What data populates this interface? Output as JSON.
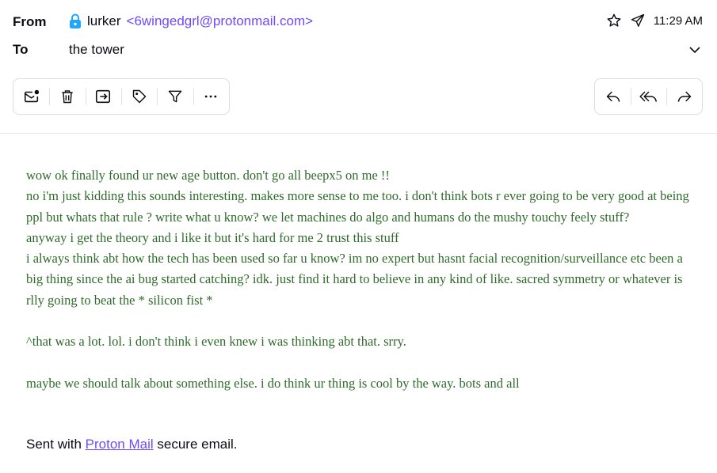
{
  "header": {
    "from_label": "From",
    "to_label": "To",
    "sender_name": "lurker",
    "sender_email": "<6wingedgrl@protonmail.com>",
    "recipient": "the tower",
    "time": "11:29 AM"
  },
  "toolbar": {
    "left": [
      {
        "icon": "mark-unread-icon"
      },
      {
        "icon": "trash-icon"
      },
      {
        "icon": "move-icon"
      },
      {
        "icon": "label-icon"
      },
      {
        "icon": "filter-icon"
      },
      {
        "icon": "more-icon"
      }
    ],
    "right": [
      {
        "icon": "reply-icon"
      },
      {
        "icon": "reply-all-icon"
      },
      {
        "icon": "forward-icon"
      }
    ]
  },
  "message": {
    "lines": [
      "wow ok finally found ur new age button. don't go all beepx5 on me !!",
      "no i'm just kidding this sounds interesting. makes more sense to me too. i don't think bots r ever going to be very good at being ppl but whats that rule ? write what u know? we let machines do algo and humans do the mushy touchy feely stuff?",
      "anyway i get the theory and i like it but it's hard for me 2 trust this stuff",
      "i always think abt how the tech has been used so far u know? im no expert but hasnt facial recognition/surveillance etc been a big thing since the ai bug started catching? idk. just find it hard to believe in any kind of like. sacred symmetry or whatever is rlly going to beat the * silicon fist *",
      "",
      "^that was a lot. lol. i don't think i even knew i was thinking abt that. srry.",
      "",
      "maybe we should talk about something else. i do think ur thing is cool by the way. bots and all"
    ]
  },
  "signature": {
    "prefix": "Sent with",
    "link": "Proton Mail",
    "suffix": "secure email."
  },
  "colors": {
    "accent": "#6d4aff",
    "body_text": "#2f6b2a",
    "lock": "#1ea7fd"
  }
}
